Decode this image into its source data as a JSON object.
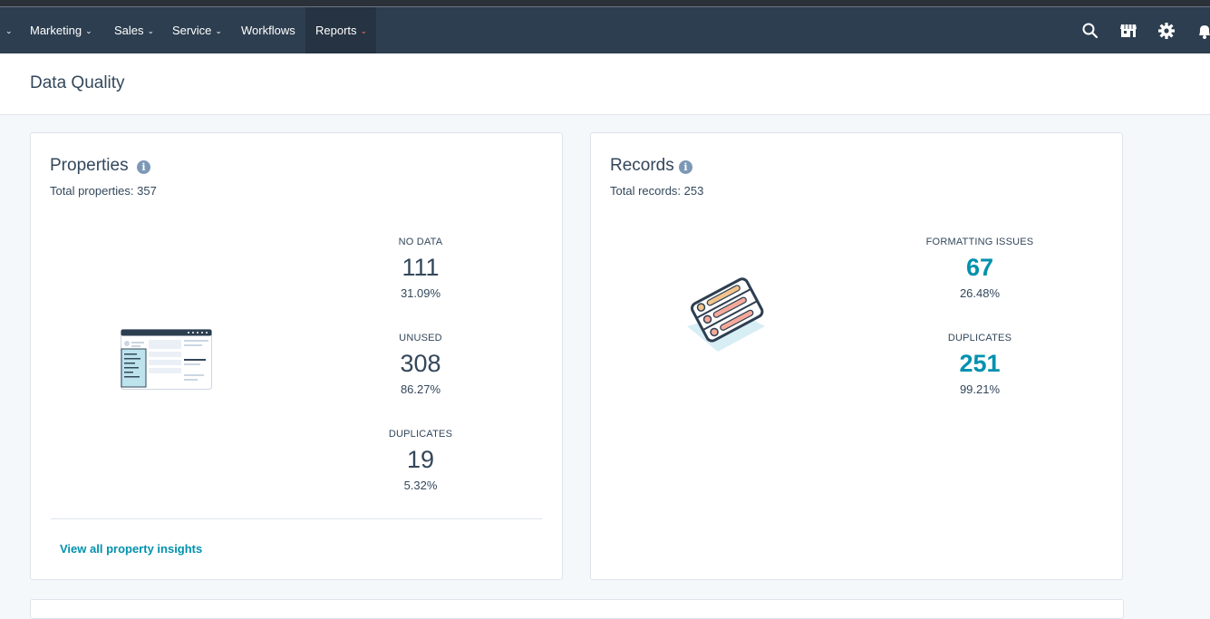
{
  "nav": {
    "items": [
      {
        "label": "Marketing",
        "has_dropdown": true
      },
      {
        "label": "Sales",
        "has_dropdown": true
      },
      {
        "label": "Service",
        "has_dropdown": true
      },
      {
        "label": "Workflows",
        "has_dropdown": false
      },
      {
        "label": "Reports",
        "has_dropdown": true,
        "active": true
      }
    ],
    "icons": [
      "search-icon",
      "marketplace-icon",
      "settings-icon",
      "notifications-icon"
    ]
  },
  "page": {
    "title": "Data Quality"
  },
  "properties_card": {
    "title": "Properties",
    "subtitle": "Total properties: 357",
    "metrics": [
      {
        "label": "NO DATA",
        "value": "111",
        "percent": "31.09%"
      },
      {
        "label": "UNUSED",
        "value": "308",
        "percent": "86.27%"
      },
      {
        "label": "DUPLICATES",
        "value": "19",
        "percent": "5.32%"
      }
    ],
    "link": "View all property insights"
  },
  "records_card": {
    "title": "Records",
    "subtitle": "Total records: 253",
    "metrics": [
      {
        "label": "FORMATTING ISSUES",
        "value": "67",
        "percent": "26.48%"
      },
      {
        "label": "DUPLICATES",
        "value": "251",
        "percent": "99.21%"
      }
    ]
  },
  "colors": {
    "nav_bg": "#2d3e50",
    "accent_orange": "#ff7a59",
    "teal": "#0091ae",
    "text": "#33475b"
  }
}
